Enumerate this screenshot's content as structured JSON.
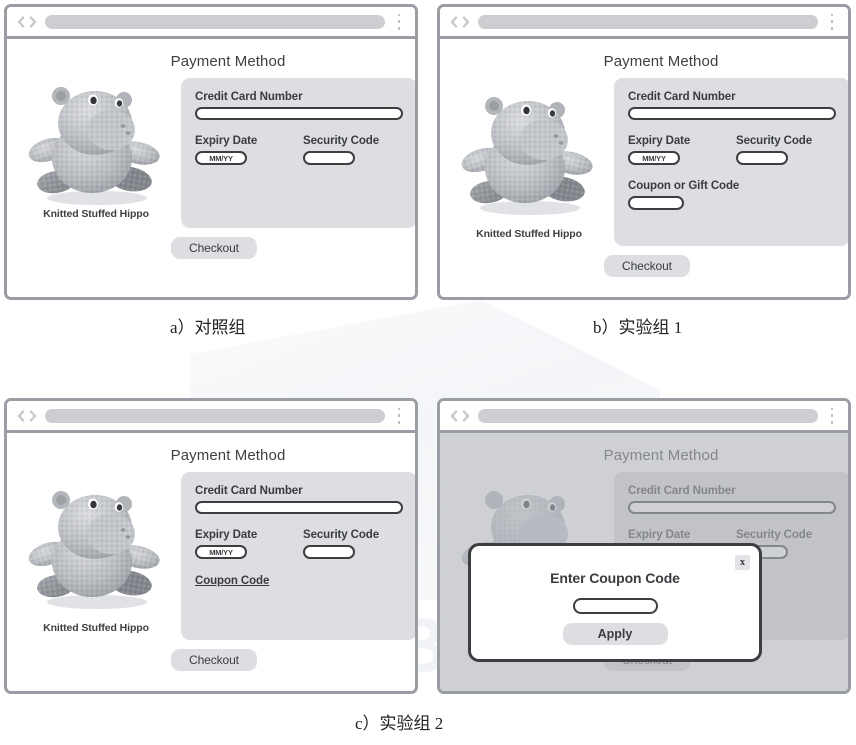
{
  "figure": {
    "captions": [
      {
        "id": "a",
        "text": "a）对照组"
      },
      {
        "id": "b",
        "text": "b）实验组 1"
      },
      {
        "id": "c",
        "text": "c）实验组 2"
      }
    ],
    "watermark": "BZ Books"
  },
  "browser": {
    "back_icon": "chevron-left-icon",
    "forward_icon": "chevron-right-icon",
    "url_value": "",
    "menu_icon": "kebab-menu-icon"
  },
  "page": {
    "title": "Payment Method",
    "product": {
      "image_alt": "knitted-stuffed-hippo",
      "caption": "Knitted Stuffed Hippo"
    },
    "fields": {
      "credit_card_label": "Credit Card Number",
      "credit_card_value": "",
      "expiry_label": "Expiry Date",
      "expiry_placeholder": "MM/YY",
      "security_label": "Security Code",
      "security_value": "",
      "coupon_gift_label": "Coupon or Gift Code",
      "coupon_gift_value": "",
      "coupon_link_label": "Coupon Code"
    },
    "checkout_label": "Checkout"
  },
  "modal": {
    "title": "Enter Coupon Code",
    "input_value": "",
    "apply_label": "Apply",
    "close_label": "x"
  },
  "colors": {
    "window_border": "#9a9da3",
    "form_panel": "#dcdee1",
    "input_border": "#3c3e42",
    "text": "#3a3c40",
    "urlbar": "#cdced2",
    "dim_overlay": "#b0b3b9"
  }
}
